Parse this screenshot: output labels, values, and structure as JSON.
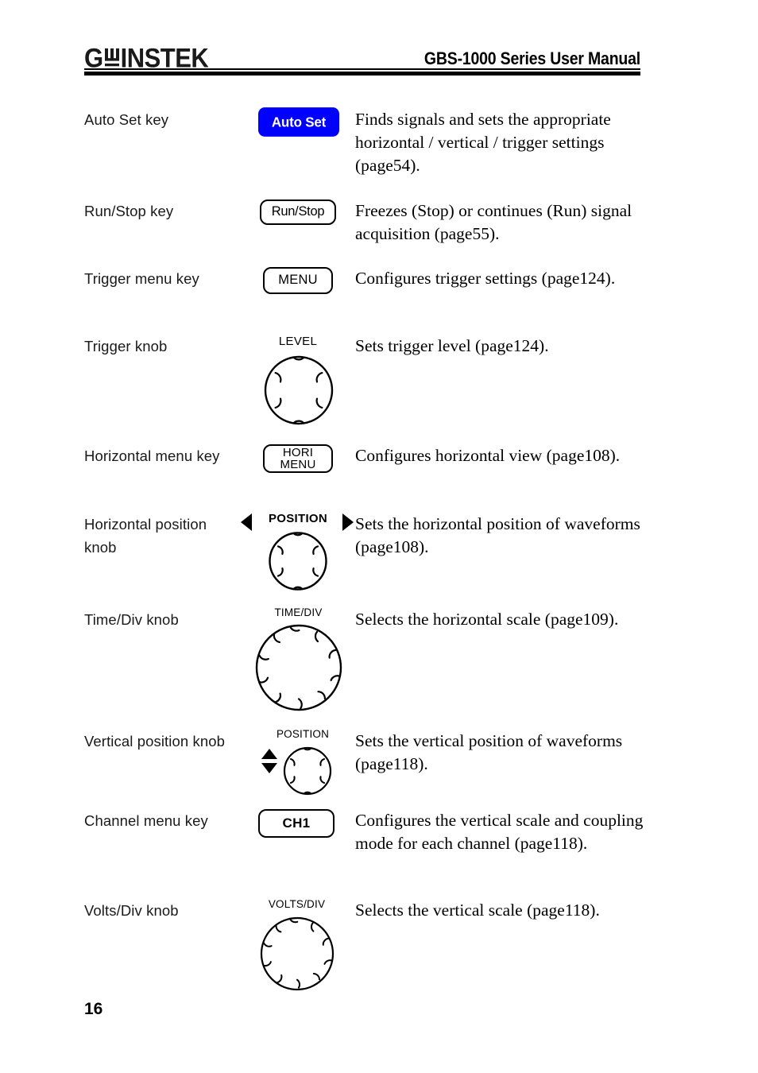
{
  "header": {
    "logo_gw": "G",
    "logo_instek": "INSTEK",
    "logo_alt": "GW INSTEK",
    "title": "GBS-1000 Series User Manual"
  },
  "footer": {
    "page_number": "16"
  },
  "colors": {
    "autoset_button_bg": "#0000ff",
    "autoset_button_text": "#ffffff",
    "text": "#000000",
    "rule": "#000000"
  },
  "rows": [
    {
      "label": "Auto Set key",
      "control_type": "button",
      "control_label": "Auto Set",
      "description": "Finds signals and sets the appropriate horizontal / vertical / trigger settings (page54)."
    },
    {
      "label": "Run/Stop key",
      "control_type": "button",
      "control_label": "Run/Stop",
      "description": "Freezes (Stop) or continues (Run) signal acquisition (page55)."
    },
    {
      "label": "Trigger menu key",
      "control_type": "button",
      "control_label": "MENU",
      "description": "Configures trigger settings (page124)."
    },
    {
      "label": "Trigger knob",
      "control_type": "knob",
      "control_label": "LEVEL",
      "description": "Sets trigger level (page124)."
    },
    {
      "label": "Horizontal menu key",
      "control_type": "button",
      "control_label_line1": "HORI",
      "control_label_line2": "MENU",
      "description": "Configures horizontal view (page108)."
    },
    {
      "label": "Horizontal position knob",
      "control_type": "knob",
      "control_label": "POSITION",
      "description": "Sets the horizontal position of waveforms (page108)."
    },
    {
      "label": "Time/Div knob",
      "control_type": "knob",
      "control_label": "TIME/DIV",
      "description": "Selects the horizontal scale (page109)."
    },
    {
      "label": "Vertical position knob",
      "control_type": "knob",
      "control_label": "POSITION",
      "description": "Sets the vertical position of waveforms (page118)."
    },
    {
      "label": "Channel menu key",
      "control_type": "button",
      "control_label": "CH1",
      "description": "Configures the vertical scale and coupling mode for each channel (page118)."
    },
    {
      "label": "Volts/Div knob",
      "control_type": "knob",
      "control_label": "VOLTS/DIV",
      "description": "Selects the vertical scale (page118)."
    }
  ]
}
